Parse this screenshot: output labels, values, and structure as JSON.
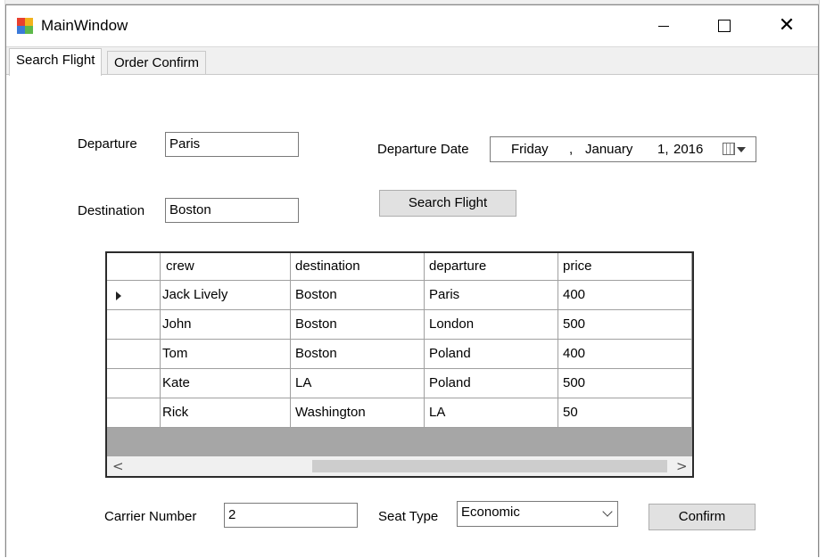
{
  "window": {
    "title": "MainWindow"
  },
  "tabs": [
    {
      "label": "Search Flight",
      "active": true
    },
    {
      "label": "Order Confirm",
      "active": false
    }
  ],
  "search": {
    "departure_label": "Departure",
    "departure_value": "Paris",
    "destination_label": "Destination",
    "destination_value": "Boston",
    "date_label": "Departure Date",
    "date": {
      "weekday": "Friday",
      "sep": ",",
      "month": "January",
      "day": "1,",
      "year": "2016"
    },
    "search_button": "Search Flight"
  },
  "grid": {
    "columns": [
      "crew",
      "destination",
      "departure",
      "price"
    ],
    "rows": [
      [
        "Jack Lively",
        "Boston",
        "Paris",
        "400"
      ],
      [
        "John",
        "Boston",
        "London",
        "500"
      ],
      [
        "Tom",
        "Boston",
        "Poland",
        "400"
      ],
      [
        "Kate",
        "LA",
        "Poland",
        "500"
      ],
      [
        "Rick",
        "Washington",
        "LA",
        "50"
      ]
    ],
    "scroll_left": "<",
    "scroll_right": ">"
  },
  "order": {
    "carrier_label": "Carrier Number",
    "carrier_value": "2",
    "seat_label": "Seat Type",
    "seat_value": "Economic",
    "confirm_button": "Confirm"
  }
}
